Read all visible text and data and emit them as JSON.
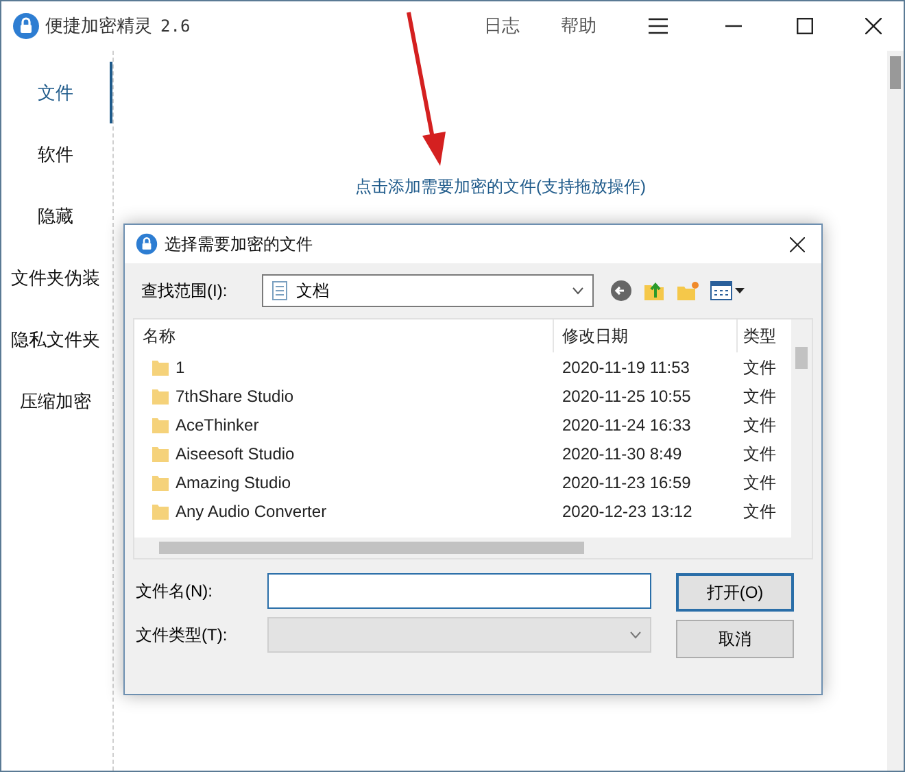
{
  "window": {
    "title": "便捷加密精灵",
    "version": "2.6",
    "menu": [
      "日志",
      "帮助"
    ]
  },
  "sidebar": {
    "items": [
      {
        "label": "文件",
        "selected": true
      },
      {
        "label": "软件",
        "selected": false
      },
      {
        "label": "隐藏",
        "selected": false
      },
      {
        "label": "文件夹伪装",
        "selected": false
      },
      {
        "label": "隐私文件夹",
        "selected": false
      },
      {
        "label": "压缩加密",
        "selected": false
      }
    ]
  },
  "content": {
    "hint": "点击添加需要加密的文件(支持拖放操作)"
  },
  "dialog": {
    "title": "选择需要加密的文件",
    "look_in": {
      "label": "查找范围(I):",
      "value": "文档"
    },
    "columns": [
      "名称",
      "修改日期",
      "类型"
    ],
    "rows": [
      {
        "name": "1",
        "modified": "2020-11-19 11:53",
        "type": "文件"
      },
      {
        "name": "7thShare Studio",
        "modified": "2020-11-25 10:55",
        "type": "文件"
      },
      {
        "name": "AceThinker",
        "modified": "2020-11-24 16:33",
        "type": "文件"
      },
      {
        "name": "Aiseesoft Studio",
        "modified": "2020-11-30 8:49",
        "type": "文件"
      },
      {
        "name": "Amazing Studio",
        "modified": "2020-11-23 16:59",
        "type": "文件"
      },
      {
        "name": "Any Audio Converter",
        "modified": "2020-12-23 13:12",
        "type": "文件"
      }
    ],
    "file_name": {
      "label": "文件名(N):"
    },
    "file_type": {
      "label": "文件类型(T):"
    },
    "buttons": [
      {
        "label": "打开(O)",
        "kind": "default"
      },
      {
        "label": "取消",
        "kind": "normal"
      }
    ]
  }
}
